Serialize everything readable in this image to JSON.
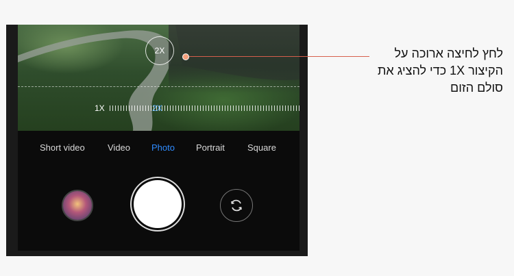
{
  "zoom": {
    "bubble_label": "2X",
    "scale_min_label": "1X",
    "scale_current_label": "2X"
  },
  "modes": [
    "Short video",
    "Video",
    "Photo",
    "Portrait",
    "Square"
  ],
  "active_mode": "Photo",
  "callout": {
    "text": "לחץ לחיצה ארוכה על הקיצור 1X כדי להציג את סולם הזום"
  },
  "icons": {
    "gallery": "gallery-thumbnail",
    "shutter": "shutter-icon",
    "switch_camera": "switch-camera-icon"
  },
  "colors": {
    "active_mode": "#2f8cff",
    "callout_line": "#d75f4c"
  }
}
